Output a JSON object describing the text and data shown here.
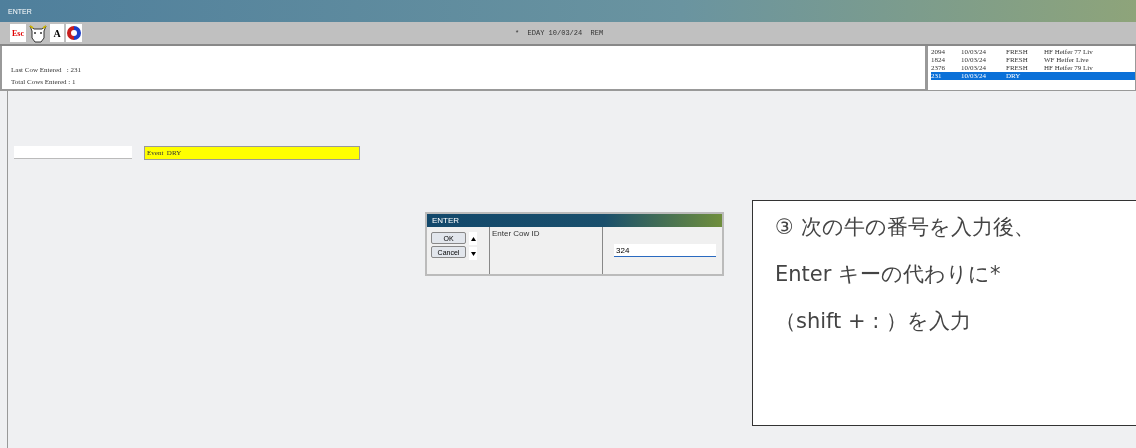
{
  "window": {
    "title": "ENTER"
  },
  "toolbar": {
    "buttons": [
      {
        "kind": "esc",
        "label": "Esc"
      },
      {
        "kind": "cow"
      },
      {
        "kind": "text",
        "label": "A"
      },
      {
        "kind": "refresh"
      }
    ],
    "status": "*  EDAY 10/03/24  REM"
  },
  "info": {
    "lines": [
      "Last Cow Entered   : 231",
      "Total Cows Entered : 1"
    ]
  },
  "recent_list": [
    {
      "id": "2094",
      "date": "10/03/24",
      "event": "FRESH",
      "note": "HF Heifer 77 Liv",
      "selected": false
    },
    {
      "id": "1824",
      "date": "10/03/24",
      "event": "FRESH",
      "note": "WF Heifer Live",
      "selected": false
    },
    {
      "id": "2376",
      "date": "10/03/24",
      "event": "FRESH",
      "note": "HF Heifer 79 Liv",
      "selected": false
    },
    {
      "id": "231",
      "date": "10/03/24",
      "event": "DRY",
      "selected": true
    }
  ],
  "entry": {
    "event_field": {
      "value": "Event  DRY"
    }
  },
  "dialog": {
    "title": "ENTER",
    "buttons": [
      "OK",
      "Cancel"
    ],
    "prompt": "Enter Cow ID",
    "value": "324"
  },
  "callout": {
    "lines": [
      "③ 次の牛の番号を入力後、",
      "Enter キーの代わりに*",
      "（shift + : ）を入力"
    ]
  }
}
